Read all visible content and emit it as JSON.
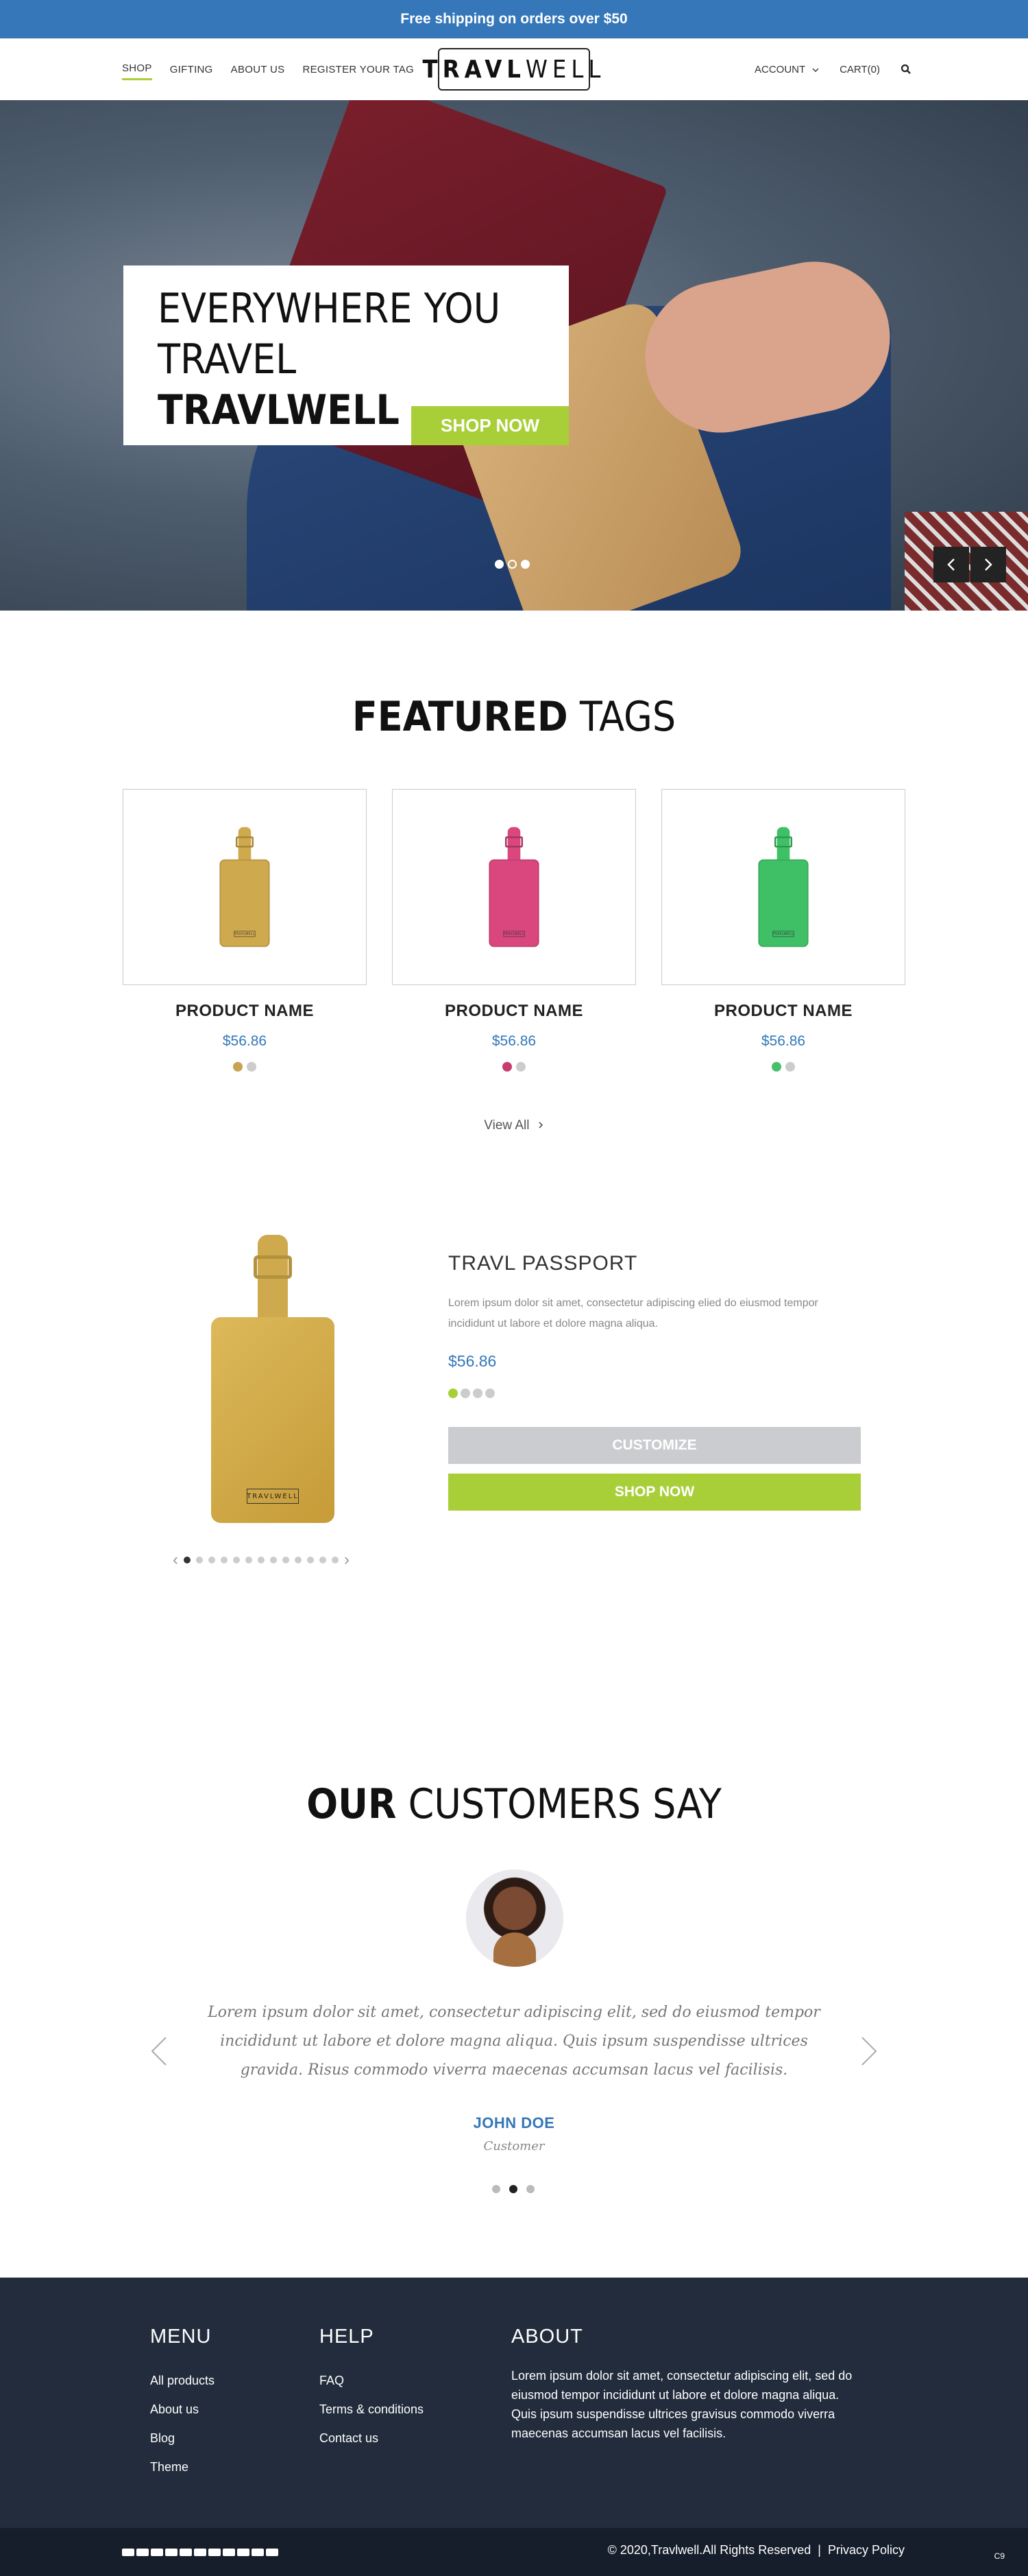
{
  "announcement": "Free shipping on orders over $50",
  "nav": {
    "left": [
      "SHOP",
      "GIFTING",
      "ABOUT US",
      "REGISTER YOUR TAG"
    ],
    "active": "SHOP",
    "logo": "TRAVLWELL",
    "account": "ACCOUNT",
    "cart": "CART(0)"
  },
  "hero": {
    "line1": "EVERYWHERE YOU",
    "line2_plain": "TRAVEL ",
    "line2_bold": "TRAVLWELL",
    "cta": "SHOP NOW",
    "slide_count": 3,
    "active_slide": 2
  },
  "featured": {
    "title_bold": "FEATURED",
    "title_plain": " TAGS",
    "products": [
      {
        "name": "PRODUCT NAME",
        "price": "$56.86",
        "color": "#cfa94e",
        "swatches": [
          "#c8a350",
          "#cccccc"
        ]
      },
      {
        "name": "PRODUCT NAME",
        "price": "$56.86",
        "color": "#d9477e",
        "swatches": [
          "#c73b6f",
          "#cccccc"
        ]
      },
      {
        "name": "PRODUCT NAME",
        "price": "$56.86",
        "color": "#3fc067",
        "swatches": [
          "#47c06a",
          "#cccccc"
        ]
      }
    ],
    "view_all": "View All"
  },
  "passport": {
    "title": "TRAVL PASSPORT",
    "description": "Lorem ipsum dolor sit amet, consectetur adipiscing elied do eiusmod tempor incididunt ut labore et dolore magna aliqua.",
    "price": "$56.86",
    "swatches": [
      "#a8cf38",
      "#cccccc",
      "#cccccc",
      "#cccccc"
    ],
    "customize": "CUSTOMIZE",
    "shop": "SHOP NOW",
    "plate": "TRAVLWELL",
    "thumb_count": 13,
    "active_thumb": 1
  },
  "testimonials": {
    "title_bold": "OUR",
    "title_plain": " CUSTOMERS SAY",
    "quote": "Lorem ipsum dolor sit amet, consectetur adipiscing elit, sed do eiusmod tempor incididunt ut labore et dolore magna aliqua. Quis ipsum suspendisse ultrices gravida. Risus commodo viverra maecenas accumsan lacus vel facilisis.",
    "name": "JOHN DOE",
    "role": "Customer",
    "dots": 3,
    "active_dot": 2
  },
  "footer": {
    "menu_title": "MENU",
    "menu": [
      "All products",
      "About us",
      "Blog",
      "Theme"
    ],
    "help_title": "HELP",
    "help": [
      "FAQ",
      "Terms & conditions",
      "Contact us"
    ],
    "about_title": "ABOUT",
    "about": "Lorem ipsum dolor sit amet, consectetur adipiscing elit, sed do eiusmod tempor incididunt ut labore et dolore magna aliqua. Quis ipsum suspendisse ultrices gravisus commodo viverra maecenas accumsan lacus vel facilisis.",
    "copyright": "© 2020,Travlwell.All Rights Reserved",
    "separator": "|",
    "privacy": "Privacy Policy",
    "corner": "C9"
  },
  "colors": {
    "blue": "#3577b9",
    "green": "#a8cf38",
    "footer_bg": "#222c3c"
  }
}
